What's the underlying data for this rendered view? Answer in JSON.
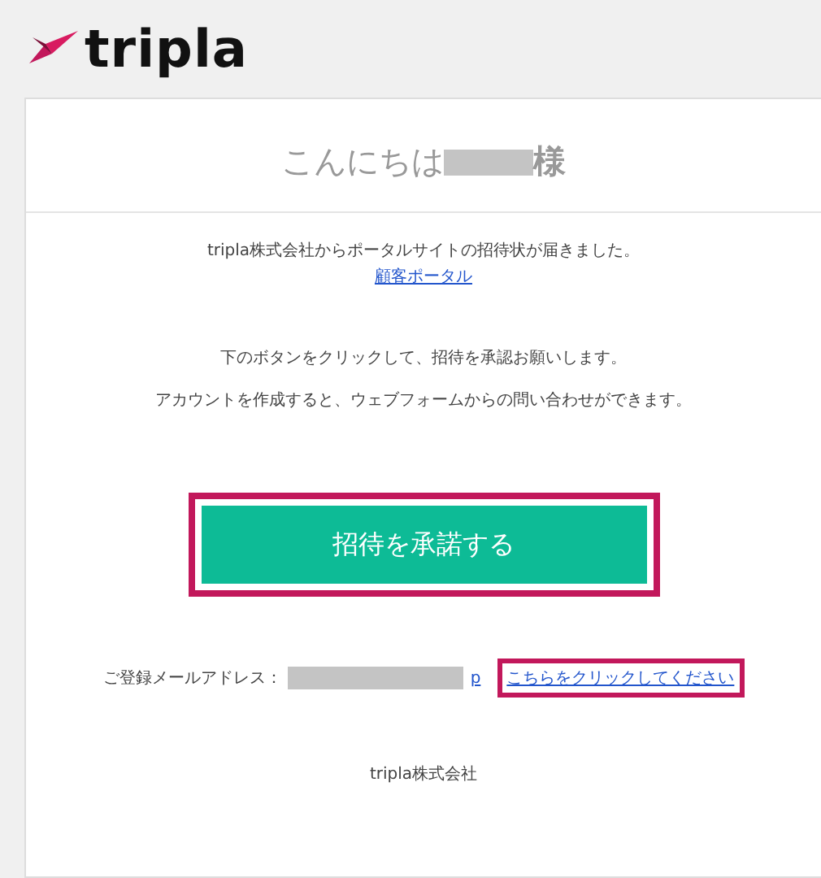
{
  "logo": {
    "text": "tripla"
  },
  "greeting": {
    "text": "こんにちは",
    "suffix": "様"
  },
  "intro": {
    "text": "tripla株式会社からポータルサイトの招待状が届きました。",
    "link": "顧客ポータル"
  },
  "instructions": [
    "下のボタンをクリックして、招待を承認お願いします。",
    "アカウントを作成すると、ウェブフォームからの問い合わせができます。"
  ],
  "accept_button": {
    "label": "招待を承諾する",
    "highlighted": true
  },
  "email": {
    "label": "ご登録メールアドレス：",
    "value_tail": "p",
    "link": "こちらをクリックしてください",
    "link_highlighted": true
  },
  "footer": {
    "text": "tripla株式会社"
  }
}
